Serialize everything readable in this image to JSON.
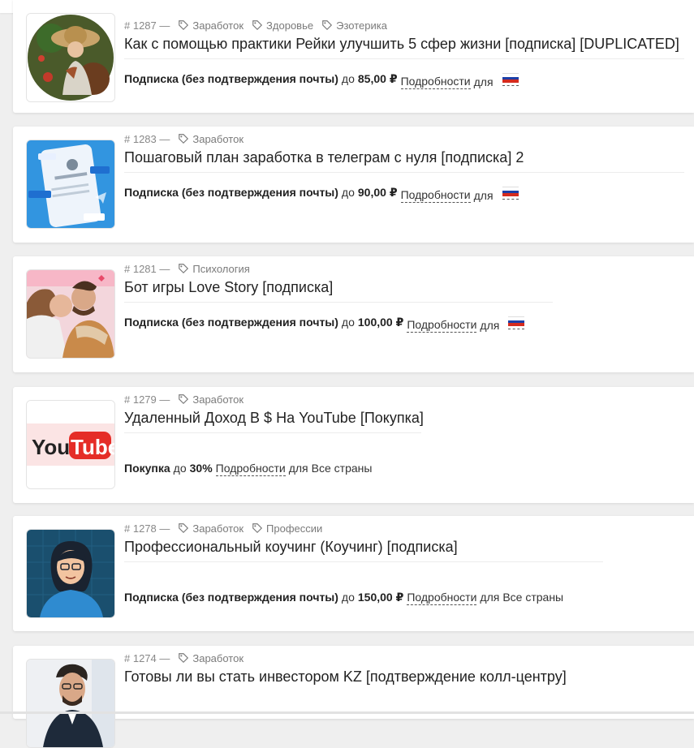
{
  "offers": [
    {
      "id": "# 1287 —",
      "tags": [
        "Заработок",
        "Здоровье",
        "Эзотерика"
      ],
      "title": "Как с помощью практики Рейки улучшить 5 сфер жизни [подписка] [DUPLICATED]",
      "type": "Подписка (без подтверждения почты)",
      "upto": "до",
      "amount": "85,00 ₽",
      "details": "Подробности",
      "for": "для",
      "region": "flag-ru"
    },
    {
      "id": "# 1283 —",
      "tags": [
        "Заработок"
      ],
      "title": "Пошаговый план заработка в телеграм с нуля [подписка] 2",
      "type": "Подписка (без подтверждения почты)",
      "upto": "до",
      "amount": "90,00 ₽",
      "details": "Подробности",
      "for": "для",
      "region": "flag-ru"
    },
    {
      "id": "# 1281 —",
      "tags": [
        "Психология"
      ],
      "title": "Бот игры Love Story [подписка]",
      "type": "Подписка (без подтверждения почты)",
      "upto": "до",
      "amount": "100,00 ₽",
      "details": "Подробности",
      "for": "для",
      "region": "flag-ru"
    },
    {
      "id": "# 1279 —",
      "tags": [
        "Заработок"
      ],
      "title": "Удаленный Доход В $ На YouTube [Покупка]",
      "type": "Покупка",
      "upto": "до",
      "amount": "30%",
      "details": "Подробности",
      "for": "для",
      "region_text": "Все страны",
      "thumb_text": [
        "You",
        "Tube"
      ]
    },
    {
      "id": "# 1278 —",
      "tags": [
        "Заработок",
        "Профессии"
      ],
      "title": "Профессиональный коучинг (Коучинг) [подписка]",
      "type": "Подписка (без подтверждения почты)",
      "upto": "до",
      "amount": "150,00 ₽",
      "details": "Подробности",
      "for": "для",
      "region_text": "Все страны"
    },
    {
      "id": "# 1274 —",
      "tags": [
        "Заработок"
      ],
      "title": "Готовы ли вы стать инвестором KZ [подтверждение колл-центру]"
    }
  ],
  "colors": {
    "flag_white": "#ffffff",
    "flag_blue": "#1c3fa8",
    "flag_red": "#d52b1e",
    "youtube_red": "#e52d27"
  }
}
